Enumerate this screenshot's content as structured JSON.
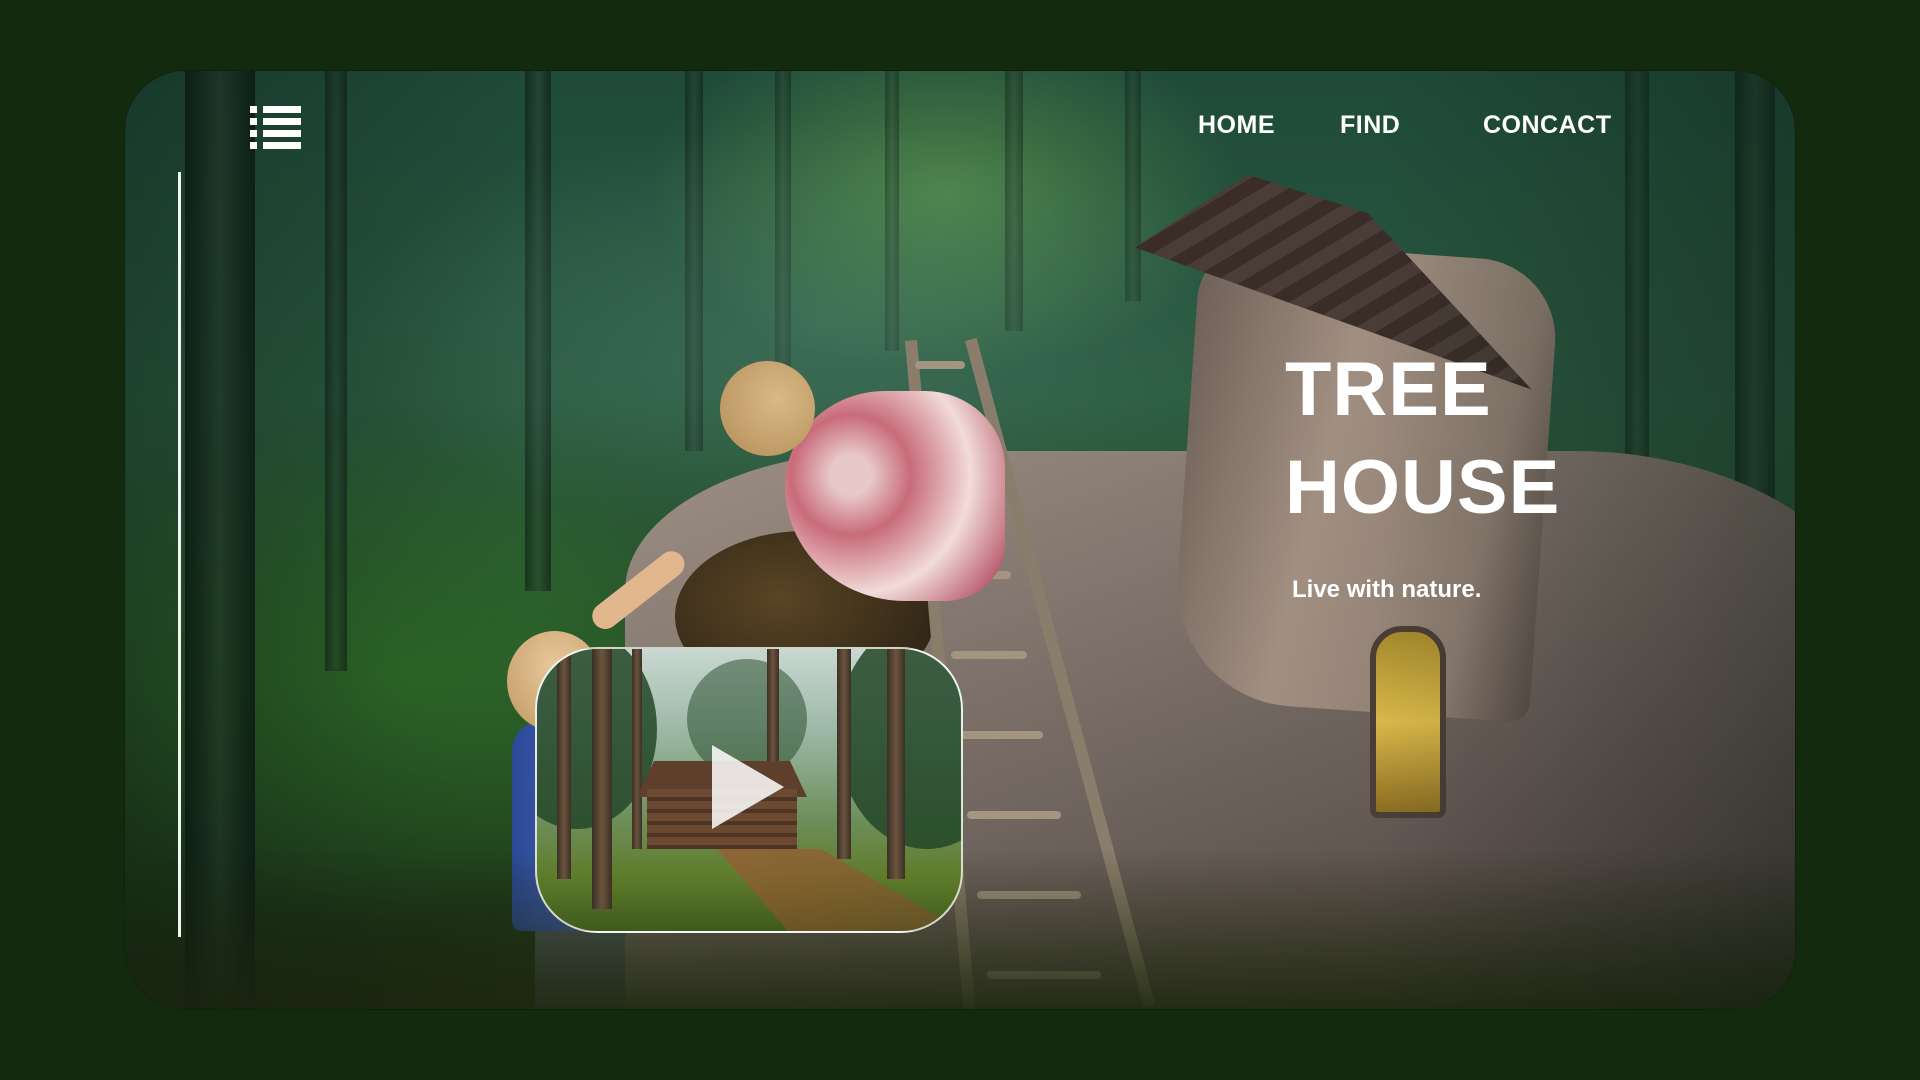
{
  "header": {
    "menu_icon": "list-menu-icon"
  },
  "nav": {
    "items": [
      {
        "label": "HOME"
      },
      {
        "label": "FIND"
      },
      {
        "label": "CONCACT"
      }
    ]
  },
  "hero": {
    "title_line1": "TREE",
    "title_line2": "HOUSE",
    "subtitle": "Live with nature."
  },
  "video": {
    "play_icon": "play-icon"
  },
  "colors": {
    "page_background": "#142a0e",
    "text": "#ffffff"
  }
}
